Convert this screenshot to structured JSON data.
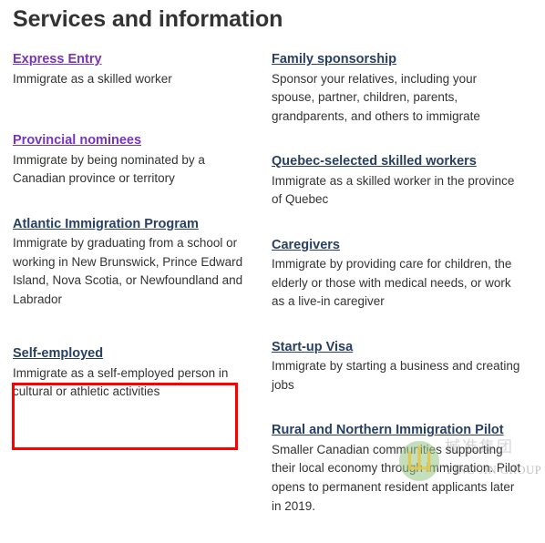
{
  "heading": "Services and information",
  "columns": {
    "left": [
      {
        "title": "Express Entry",
        "state": "visited",
        "desc": "Immigrate as a skilled worker",
        "spacing": "gap-xl"
      },
      {
        "title": "Provincial nominees",
        "state": "visited",
        "desc": "Immigrate by being nominated by a Canadian province or territory",
        "spacing": "gap-md"
      },
      {
        "title": "Atlantic Immigration Program",
        "state": "unvisited",
        "desc": "Immigrate by graduating from a school or working in New Brunswick, Prince Edward Island, Nova Scotia, or Newfoundland and Labrador",
        "spacing": "gap-lg"
      },
      {
        "title": "Self-employed",
        "state": "unvisited",
        "desc": "Immigrate as a self-employed person in cultural or athletic activities",
        "spacing": "gap-md",
        "highlighted": true
      }
    ],
    "right": [
      {
        "title": "Family sponsorship",
        "state": "unvisited",
        "desc": "Sponsor your relatives, including your spouse, partner, children, parents, grandparents, and others to immigrate",
        "spacing": "gap-md"
      },
      {
        "title": "Quebec-selected skilled workers",
        "state": "unvisited",
        "desc": "Immigrate as a skilled worker in the province of Quebec",
        "spacing": "gap-md"
      },
      {
        "title": "Caregivers",
        "state": "unvisited",
        "desc": "Immigrate by providing care for children, the elderly or those with medical needs, or work as a live-in caregiver",
        "spacing": "gap-md"
      },
      {
        "title": "Start-up Visa",
        "state": "unvisited",
        "desc": "Immigrate by starting a business and creating jobs",
        "spacing": "gap-md"
      },
      {
        "title": "Rural and Northern Immigration Pilot",
        "state": "unvisited",
        "desc": "Smaller Canadian communities supporting their local economy through immigration. Pilot opens to permanent resident applicants later in 2019.",
        "spacing": "gap-md"
      }
    ]
  },
  "annotation": {
    "highlight_color": "#fe0000",
    "target": "Self-employed"
  },
  "watermark": {
    "logo_glyph": "山",
    "chinese_text": "楲准集团",
    "english_text": "YING JIN GROUP"
  },
  "colors": {
    "visited_link": "#7834bc",
    "unvisited_link": "#284162",
    "body_text": "#333333",
    "heading": "#333333",
    "background": "#ffffff"
  }
}
